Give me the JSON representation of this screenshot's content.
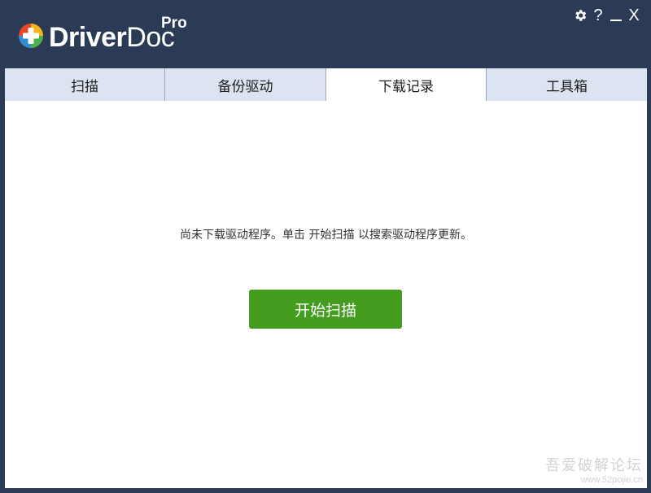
{
  "app": {
    "brand_driver": "Driver",
    "brand_doc": "Doc",
    "brand_pro": "Pro"
  },
  "window_controls": {
    "help": "?",
    "close": "X"
  },
  "tabs": [
    {
      "label": "扫描",
      "active": false
    },
    {
      "label": "备份驱动",
      "active": false
    },
    {
      "label": "下载记录",
      "active": true
    },
    {
      "label": "工具箱",
      "active": false
    }
  ],
  "main": {
    "message": "尚未下载驱动程序。单击 开始扫描 以搜索驱动程序更新。",
    "scan_button": "开始扫描"
  },
  "watermark": {
    "line1": "吾爱破解论坛",
    "line2": "www.52pojie.cn"
  },
  "colors": {
    "titlebar": "#2b3a55",
    "tab_inactive": "#dbe4f0",
    "tab_active": "#ffffff",
    "button": "#449d1f"
  },
  "icons": {
    "logo": "driverdoc-plus-logo",
    "settings": "gear-icon",
    "help": "question-icon",
    "minimize": "minimize-icon",
    "close": "close-icon"
  }
}
